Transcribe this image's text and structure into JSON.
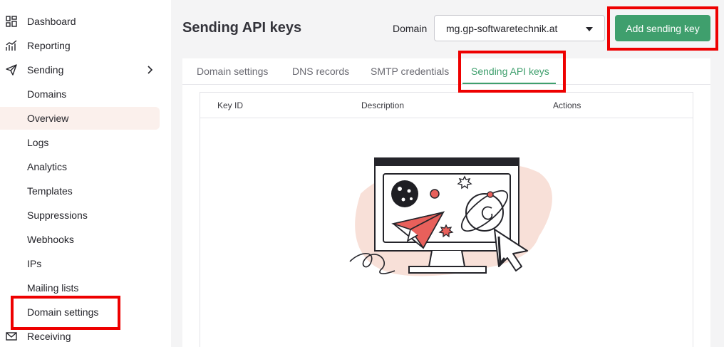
{
  "sidebar": {
    "items": [
      {
        "label": "Dashboard",
        "icon": "dashboard-icon"
      },
      {
        "label": "Reporting",
        "icon": "reporting-icon"
      },
      {
        "label": "Sending",
        "icon": "send-icon"
      },
      {
        "label": "Domains"
      },
      {
        "label": "Overview"
      },
      {
        "label": "Logs"
      },
      {
        "label": "Analytics"
      },
      {
        "label": "Templates"
      },
      {
        "label": "Suppressions"
      },
      {
        "label": "Webhooks"
      },
      {
        "label": "IPs"
      },
      {
        "label": "Mailing lists"
      },
      {
        "label": "Domain settings"
      },
      {
        "label": "Receiving",
        "icon": "mail-icon"
      }
    ]
  },
  "header": {
    "title": "Sending API keys",
    "domain_label": "Domain",
    "domain_value": "mg.gp-softwaretechnik.at",
    "add_button": "Add sending key"
  },
  "tabs": [
    {
      "label": "Domain settings"
    },
    {
      "label": "DNS records"
    },
    {
      "label": "SMTP credentials"
    },
    {
      "label": "Sending API keys",
      "active": true
    }
  ],
  "table": {
    "columns": [
      "Key ID",
      "Description",
      "Actions"
    ]
  },
  "colors": {
    "accent": "#3f9f6d",
    "highlight": "#ee0000",
    "active_bg": "#fbf0ec"
  }
}
